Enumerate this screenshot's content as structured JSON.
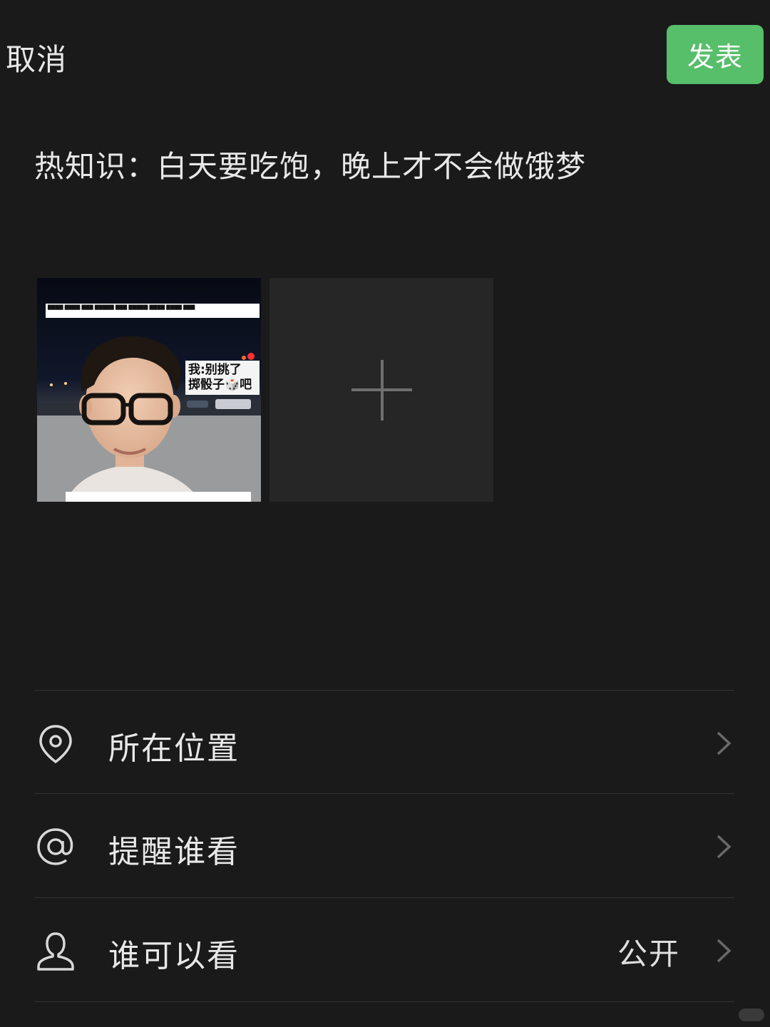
{
  "header": {
    "cancel_label": "取消",
    "publish_label": "发表",
    "publish_color": "#57be6a"
  },
  "post": {
    "text": "热知识：白天要吃饱，晚上才不会做饿梦"
  },
  "media": {
    "photo": {
      "bubble_line1": "我:别挑了",
      "bubble_line2": "掷骰子🎲吧"
    },
    "add_icon": "plus-icon"
  },
  "options": [
    {
      "icon": "location-pin-icon",
      "label": "所在位置",
      "value": ""
    },
    {
      "icon": "at-sign-icon",
      "label": "提醒谁看",
      "value": ""
    },
    {
      "icon": "person-icon",
      "label": "谁可以看",
      "value": "公开"
    }
  ],
  "colors": {
    "background": "#1a1a1a",
    "divider": "#333333",
    "add_tile": "#262626"
  }
}
